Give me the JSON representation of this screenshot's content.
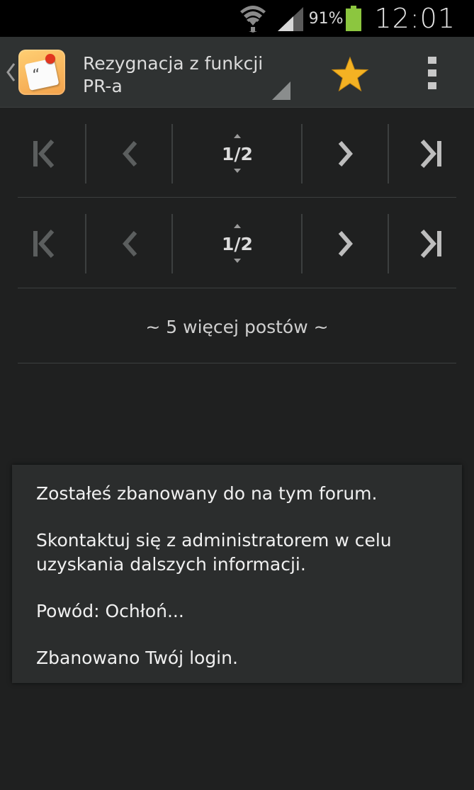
{
  "status_bar": {
    "battery_percent": "91%",
    "time": "12:01",
    "battery_color": "#8cc63f"
  },
  "action_bar": {
    "title": "Rezygnacja z funkcji PR-a",
    "star_color": "#f4b223"
  },
  "pager_top": {
    "page_indicator": "1/2"
  },
  "pager_bottom": {
    "page_indicator": "1/2"
  },
  "more_posts_label": "~ 5 więcej postów ~",
  "ban_dialog": {
    "line1": "Zostałeś zbanowany do  na tym forum.",
    "line2": "Skontaktuj się z administratorem w celu uzyskania dalszych informacji.",
    "line3": "Powód: Ochłoń...",
    "line4": "Zbanowano Twój login."
  }
}
